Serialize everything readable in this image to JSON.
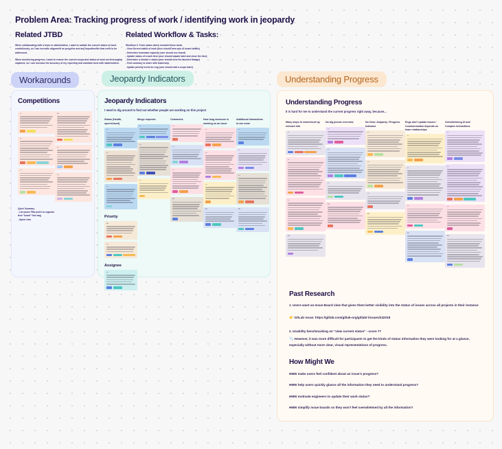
{
  "board": {
    "title": "Problem Area: Tracking progress of work / identifying work in jeopardy",
    "background": "#f7f7f8",
    "dot_color": "#d8d8dd"
  },
  "jtbd": {
    "heading": "Related JTBD",
    "paragraphs": [
      "When collaborating with a team or stakeholders, I want to radiate the current status of work continuously, so I can increase alignment on progress and any impediments that need to be addressed.",
      "When monitoring progress, I want to ensure the current scope and status of work are thoroughly captured, so I can increase the accuracy of my reporting and maintain trust with stakeholders."
    ]
  },
  "workflow": {
    "heading": "Related Workflow & Tasks:",
    "lines": [
      "Workflow 3: Track status which included these tasks",
      "- View current status of work (user should view epic or board details)",
      "- Determine teammate capacity (user should use board)",
      "- Update status of a work item (user should udpate label and close the item)",
      "- Determine a blocker's status (user should view the blocked linkage)",
      "- Find summary to share with leadership",
      "- Update priority levels for eng (user should add a scope label)"
    ]
  },
  "sections": {
    "workarounds": {
      "pill": "Workarounds",
      "color": "#ccd3f7"
    },
    "jeopardy": {
      "pill": "Jeopardy Indicators",
      "color": "#cdf0e6"
    },
    "understanding": {
      "pill": "Understanding Progress",
      "color": "#fce7d0"
    }
  },
  "workarounds_panel": {
    "title": "Competitions",
    "quick_summary": [
      "Quick Summary",
      "- List (some PMs prefer to organize",
      "their \"board\" this way)",
      "- Sprint view"
    ],
    "columns": [
      {
        "notes": [
          {
            "id": "P1",
            "lines": 6,
            "bg": "#fde6df",
            "chips": [
              "#f3a14a",
              "#f0e05a"
            ]
          },
          {
            "id": "P2",
            "lines": 9,
            "bg": "#fde6df",
            "chips": [
              "#e8735c",
              "#f7b955",
              "#8ad3d8"
            ]
          },
          {
            "id": "P3",
            "lines": 8,
            "bg": "#fde6df",
            "chips": [
              "#b7e0a0",
              "#f7b955"
            ]
          }
        ]
      },
      {
        "notes": [
          {
            "id": "P4",
            "lines": 10,
            "bg": "#fde6df",
            "chips": [
              "#e8735c",
              "#f0e05a"
            ]
          },
          {
            "id": "P5",
            "lines": 7,
            "bg": "#fde6df",
            "chips": [
              "#9fc7f0",
              "#f3a14a"
            ]
          },
          {
            "id": "P6",
            "lines": 9,
            "bg": "#fde6df",
            "chips": [
              "#cbb2ea",
              "#8ad3d8"
            ]
          }
        ]
      }
    ]
  },
  "jeopardy_panel": {
    "title": "Jeopardy Indicators",
    "subtitle": "I need to dig around to find out whether people are working on this project",
    "columns": [
      {
        "header": "Status (Health, open/closed)",
        "notes": [
          {
            "id": "P1",
            "lines": 5,
            "bg": "#bcd9f2",
            "chips": [
              "#4dc7c0",
              "#5b7fe0"
            ]
          },
          {
            "id": "P2",
            "lines": 10,
            "bg": "#efe2d4",
            "chips": [
              "#f3a14a",
              "#e8735c"
            ]
          },
          {
            "id": "P3",
            "lines": 7,
            "bg": "#bcd9f2",
            "chips": [
              "#8ad3d8"
            ]
          }
        ],
        "sub_sections": [
          {
            "header": "Priority",
            "notes": [
              {
                "id": "P4",
                "lines": 4,
                "bg": "#f6e9d8",
                "chips": [
                  "#e8735c",
                  "#f3a14a"
                ]
              },
              {
                "id": "P5",
                "lines": 3,
                "bg": "#f6e9d8",
                "chips": [
                  "#5b7fe0",
                  "#4dc7c0",
                  "#f7b955"
                ]
              }
            ]
          },
          {
            "header": "Assignee",
            "notes": [
              {
                "id": "P6",
                "lines": 5,
                "bg": "#cdeff0",
                "chips": [
                  "#5b7fe0",
                  "#4dc7c0"
                ]
              }
            ]
          }
        ]
      },
      {
        "header": "Merge requests",
        "notes": [
          {
            "id": "P1",
            "lines": 3,
            "bg": "#bcd9f2",
            "chips": [
              "#4dc7c0",
              "#5b7fe0",
              "#7a8ce8"
            ]
          },
          {
            "id": "P2",
            "lines": 11,
            "bg": "#e6e0d6",
            "chips": [
              "#5b7fe0",
              "#3f51b5"
            ]
          },
          {
            "id": "P3",
            "lines": 5,
            "bg": "#fdf0c9",
            "chips": [
              "#f7b955"
            ]
          }
        ],
        "sub_sections": []
      },
      {
        "header": "Comments",
        "notes": [
          {
            "id": "P1",
            "lines": 4,
            "bg": "#fde0e6",
            "chips": [
              "#e8735c"
            ]
          },
          {
            "id": "P2",
            "lines": 5,
            "bg": "#d9e2f5",
            "chips": [
              "#8ad3d8",
              "#b07fe0"
            ]
          },
          {
            "id": "P3",
            "lines": 8,
            "bg": "#fde0e6",
            "chips": [
              "#e05c9b",
              "#f3a14a"
            ]
          },
          {
            "id": "P4",
            "lines": 7,
            "bg": "#e6e0d6",
            "chips": [
              "#5b7fe0"
            ]
          }
        ],
        "sub_sections": []
      },
      {
        "header": "How long someone is working on an issue",
        "notes": [
          {
            "id": "P1",
            "lines": 5,
            "bg": "#fde0e6",
            "chips": [
              "#e8735c",
              "#f3a14a"
            ]
          },
          {
            "id": "P2",
            "lines": 9,
            "bg": "#fde0e6",
            "chips": [
              "#b07fe0",
              "#f7b955"
            ]
          },
          {
            "id": "P3",
            "lines": 6,
            "bg": "#fdf0c9",
            "chips": [
              "#f3a14a"
            ]
          },
          {
            "id": "P4",
            "lines": 5,
            "bg": "#d9e2f5",
            "chips": [
              "#5b7fe0",
              "#4dc7c0"
            ]
          }
        ],
        "sub_sections": []
      },
      {
        "header": "Additional interactions to see more",
        "notes": [
          {
            "id": "P1",
            "lines": 4,
            "bg": "#bcd9f2",
            "chips": [
              "#5b7fe0"
            ]
          },
          {
            "id": "P2",
            "lines": 6,
            "bg": "#e8e2f5",
            "chips": [
              "#b07fe0",
              "#7a8ce8"
            ]
          },
          {
            "id": "P3",
            "lines": 10,
            "bg": "#e6e0d6",
            "chips": [
              "#f3a14a",
              "#e8735c"
            ]
          },
          {
            "id": "P4",
            "lines": 7,
            "bg": "#d9e2f5",
            "chips": [
              "#4dc7c0",
              "#5b7fe0"
            ]
          }
        ],
        "sub_sections": []
      }
    ]
  },
  "understanding_panel": {
    "title": "Understanding Progress",
    "subtitle": "It is hard for me to understand the current progress right away, because...",
    "columns": [
      {
        "header": "Many steps to search/surf up relevant info",
        "notes": [
          {
            "id": "P1",
            "lines": 7,
            "bg": "#e8e4ee",
            "chips": [
              "#5b7fe0",
              "#e8735c",
              "#f3a14a"
            ]
          },
          {
            "id": "P2",
            "lines": 13,
            "bg": "#fde0e6",
            "chips": [
              "#f3a14a",
              "#e05c9b"
            ]
          },
          {
            "id": "P3",
            "lines": 11,
            "bg": "#fde0e6",
            "chips": [
              "#f7b955",
              "#4dc7c0"
            ]
          },
          {
            "id": "P4",
            "lines": 6,
            "bg": "#e8e4ee",
            "chips": [
              "#b07fe0"
            ]
          }
        ]
      },
      {
        "header": "No big picture overview",
        "notes": [
          {
            "id": "P1",
            "lines": 4,
            "bg": "#ece0f7",
            "chips": [
              "#b07fe0",
              "#e05c9b"
            ]
          },
          {
            "id": "P2",
            "lines": 10,
            "bg": "#d9e2f5",
            "chips": [
              "#b07fe0",
              "#4dc7c0",
              "#5b7fe0"
            ]
          },
          {
            "id": "P3",
            "lines": 4,
            "bg": "#e8e4ee",
            "chips": [
              "#b7e0a0",
              "#4dc7c0"
            ]
          },
          {
            "id": "P4",
            "lines": 8,
            "bg": "#fde0e6",
            "chips": [
              "#e8735c"
            ]
          }
        ]
      },
      {
        "header": "No Clear Jeopardy / Progress Indicator",
        "notes": [
          {
            "id": "P1",
            "lines": 8,
            "bg": "#f6e9d8",
            "chips": [
              "#f7b955",
              "#b7e0a0"
            ]
          },
          {
            "id": "P2",
            "lines": 9,
            "bg": "#f6e9d8",
            "chips": [
              "#b7e0a0",
              "#f3a14a"
            ]
          },
          {
            "id": "P3",
            "lines": 4,
            "bg": "#e8e4ee",
            "chips": [
              "#e8735c"
            ]
          },
          {
            "id": "P4",
            "lines": 6,
            "bg": "#fdf0c9",
            "chips": [
              "#f7b955",
              "#5b7fe0"
            ]
          }
        ]
      },
      {
        "header": "Engs don't update issues / Communication depends on team relationships",
        "notes": [
          {
            "id": "P1",
            "lines": 9,
            "bg": "#fdf0c9",
            "chips": [
              "#f7b955",
              "#f3a14a"
            ]
          },
          {
            "id": "P2",
            "lines": 12,
            "bg": "#e8e4ee",
            "chips": [
              "#5b7fe0",
              "#b07fe0"
            ]
          },
          {
            "id": "P3",
            "lines": 7,
            "bg": "#fde0e6",
            "chips": [
              "#e05c9b",
              "#4dc7c0"
            ]
          },
          {
            "id": "P4",
            "lines": 10,
            "bg": "#d9e2f5",
            "chips": [
              "#5b7fe0"
            ]
          }
        ]
      },
      {
        "header": "Overwhelming UI and Complex interactions",
        "notes": [
          {
            "id": "P1",
            "lines": 10,
            "bg": "#ece0f7",
            "chips": [
              "#b07fe0",
              "#7a8ce8"
            ]
          },
          {
            "id": "P2",
            "lines": 13,
            "bg": "#ece0f7",
            "chips": [
              "#e8735c",
              "#f3a14a",
              "#4dc7c0"
            ]
          },
          {
            "id": "P3",
            "lines": 8,
            "bg": "#fde0e6",
            "chips": [
              "#e05c9b"
            ]
          },
          {
            "id": "P4",
            "lines": 11,
            "bg": "#e8e4ee",
            "chips": [
              "#5b7fe0",
              "#b7e0a0"
            ]
          }
        ]
      }
    ]
  },
  "past_research": {
    "heading": "Past Research",
    "item1": "1. Users want an Issue Board view that gives them better visibility into the status of issues across all projects in their instance",
    "item1_link_emoji": "👉",
    "item1_link": "GitLab issue: https://gitlab.com/gitlab-org/gitlab/-/issues/242018",
    "item2": "2. Usability benchmarking on \"view current status\" - score 77",
    "item2_emoji": "📉",
    "item2_detail": "However, it was more difficult for participants to get the kinds of status information they were looking for at a glance, especially without more clear, visual representations of progress."
  },
  "how_might_we": {
    "heading": "How Might We",
    "items": [
      "HMW make users feel confident about an issue's progress?",
      "HMW help users quickly glance all the information they need to understand progress?",
      "HMW motivate engineers to update their work status?",
      "HMW simplify issue boards so they won't feel overwhelmed by all the information?"
    ]
  }
}
